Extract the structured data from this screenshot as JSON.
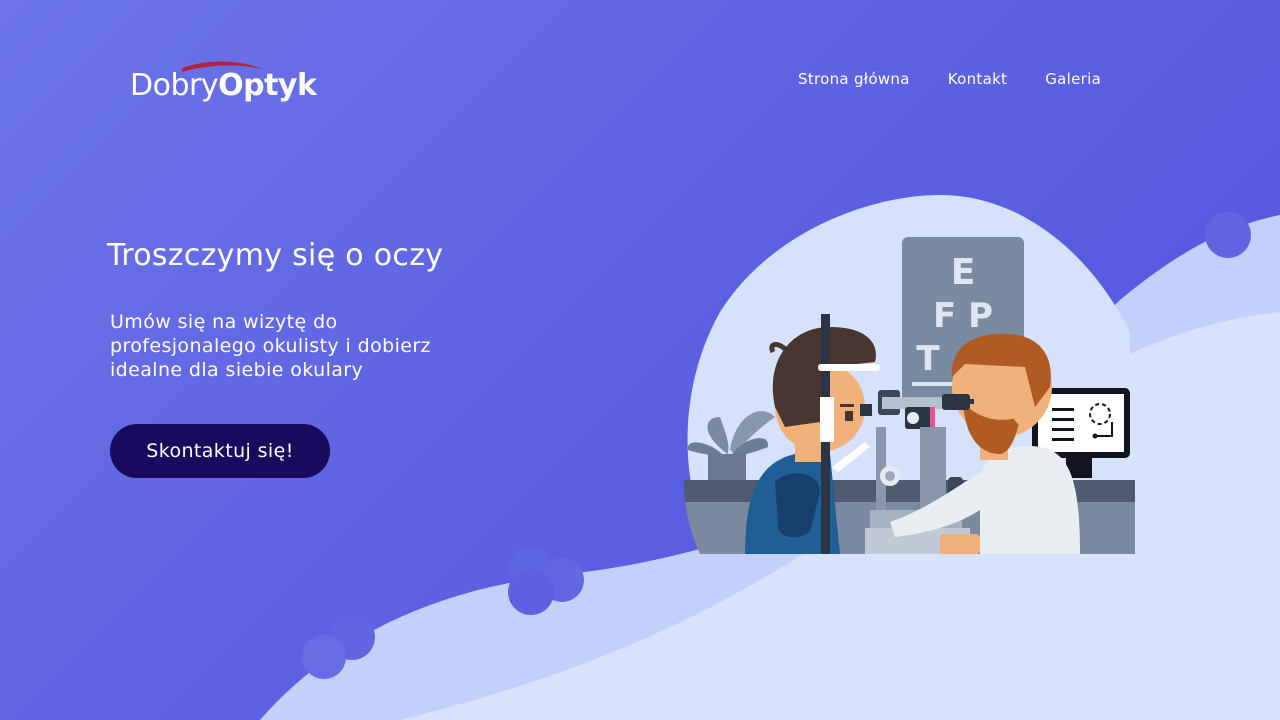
{
  "brand": {
    "logo_light": "Dobry",
    "logo_bold": "Optyk",
    "swoosh_color": "#b0243e"
  },
  "nav": {
    "items": [
      {
        "label": "Strona główna"
      },
      {
        "label": "Kontakt"
      },
      {
        "label": "Galeria"
      }
    ]
  },
  "hero": {
    "title": "Troszczymy się o oczy",
    "subtitle": "Umów się na wizytę do profesjonalego okulisty i dobierz idealne dla siebie okulary",
    "cta_label": "Skontaktuj się!"
  },
  "illustration": {
    "chart_line_1": "E",
    "chart_line_2": "F P",
    "chart_line_3": "T"
  },
  "colors": {
    "background_start": "#6c74e8",
    "background_end": "#4f53dd",
    "button": "#1a0a5e",
    "wave_light": "#d9e2fb",
    "wave_mid": "#c3d0fb"
  }
}
